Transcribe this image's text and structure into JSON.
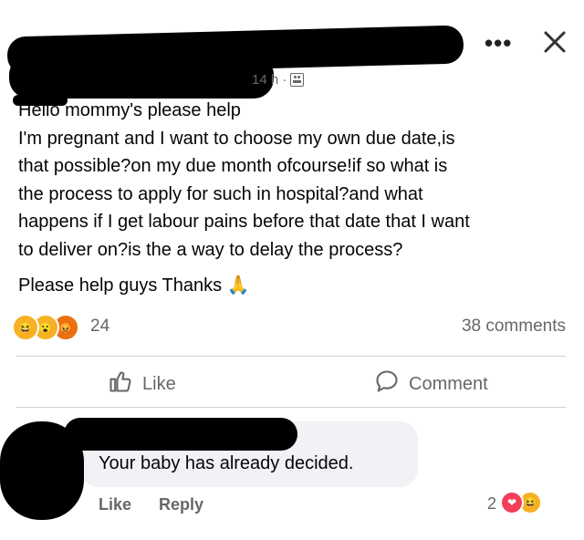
{
  "post": {
    "time": "14 h ·",
    "privacy_icon": "friends-icon",
    "more_icon": "ellipsis-icon",
    "close_icon": "close-icon",
    "body_lines": [
      "Hello mommy's please help",
      "I'm pregnant and I want to choose my own due date,is",
      "that possible?on my due month ofcourse!if so what is",
      "the process to apply for such in hospital?and what",
      "happens if I get labour pains before that date that I want",
      "to deliver on?is the a way to delay the process?"
    ],
    "closing": "Please help guys Thanks",
    "closing_emoji": "🙏"
  },
  "reactions": {
    "emojis": [
      "😆",
      "😮",
      "😡"
    ],
    "count": "24",
    "comments_count": "38 comments"
  },
  "actions": {
    "like": "Like",
    "comment": "Comment"
  },
  "comment": {
    "text": "Your baby has already decided.",
    "like": "Like",
    "reply": "Reply",
    "reaction_count": "2",
    "reaction_emojis": [
      "❤",
      "😆"
    ]
  },
  "colors": {
    "text": "#050505",
    "muted": "#65676b",
    "bubble": "#f0f2f5",
    "divider": "#ced0d4",
    "love": "#f33e58",
    "haha": "#f7b125",
    "angry": "#e9710f"
  }
}
